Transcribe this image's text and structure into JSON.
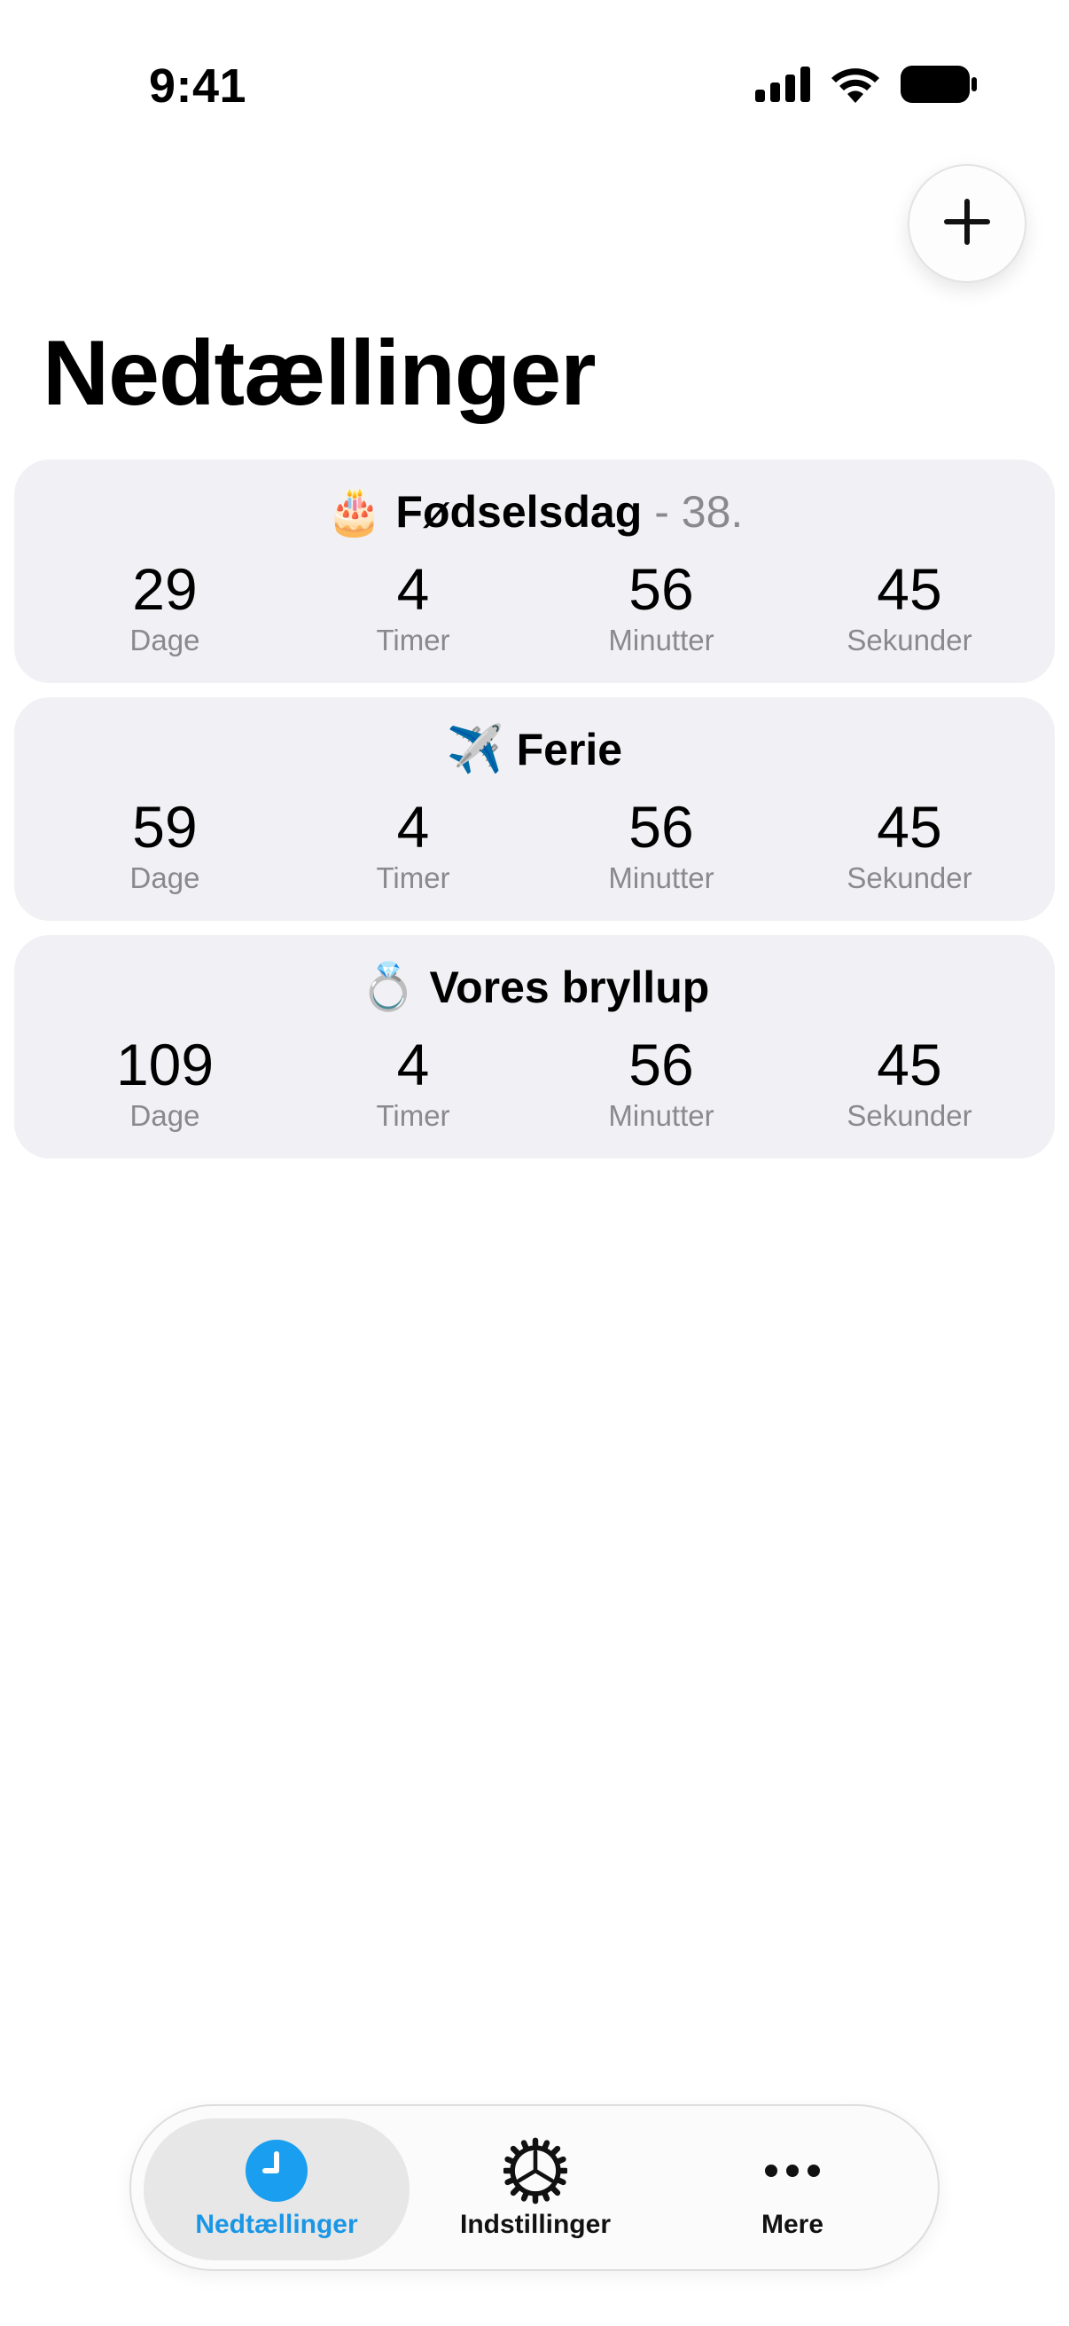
{
  "status_bar": {
    "time": "9:41",
    "icons": [
      "cellular-signal-icon",
      "wifi-icon",
      "battery-icon"
    ]
  },
  "header": {
    "add_icon": "plus-icon",
    "title": "Nedtællinger"
  },
  "countdowns": [
    {
      "emoji": "🎂",
      "name": "Fødselsdag",
      "suffix": "- 38.",
      "units": [
        {
          "value": "29",
          "label": "Dage"
        },
        {
          "value": "4",
          "label": "Timer"
        },
        {
          "value": "56",
          "label": "Minutter"
        },
        {
          "value": "45",
          "label": "Sekunder"
        }
      ]
    },
    {
      "emoji": "✈️",
      "name": "Ferie",
      "suffix": "",
      "units": [
        {
          "value": "59",
          "label": "Dage"
        },
        {
          "value": "4",
          "label": "Timer"
        },
        {
          "value": "56",
          "label": "Minutter"
        },
        {
          "value": "45",
          "label": "Sekunder"
        }
      ]
    },
    {
      "emoji": "💍",
      "name": "Vores bryllup",
      "suffix": "",
      "units": [
        {
          "value": "109",
          "label": "Dage"
        },
        {
          "value": "4",
          "label": "Timer"
        },
        {
          "value": "56",
          "label": "Minutter"
        },
        {
          "value": "45",
          "label": "Sekunder"
        }
      ]
    }
  ],
  "tab_bar": {
    "tabs": [
      {
        "label": "Nedtællinger",
        "icon": "clock-icon",
        "active": true
      },
      {
        "label": "Indstillinger",
        "icon": "gear-icon",
        "active": false
      },
      {
        "label": "Mere",
        "icon": "more-dots-icon",
        "active": false
      }
    ],
    "accent_color": "#1a96e6"
  }
}
